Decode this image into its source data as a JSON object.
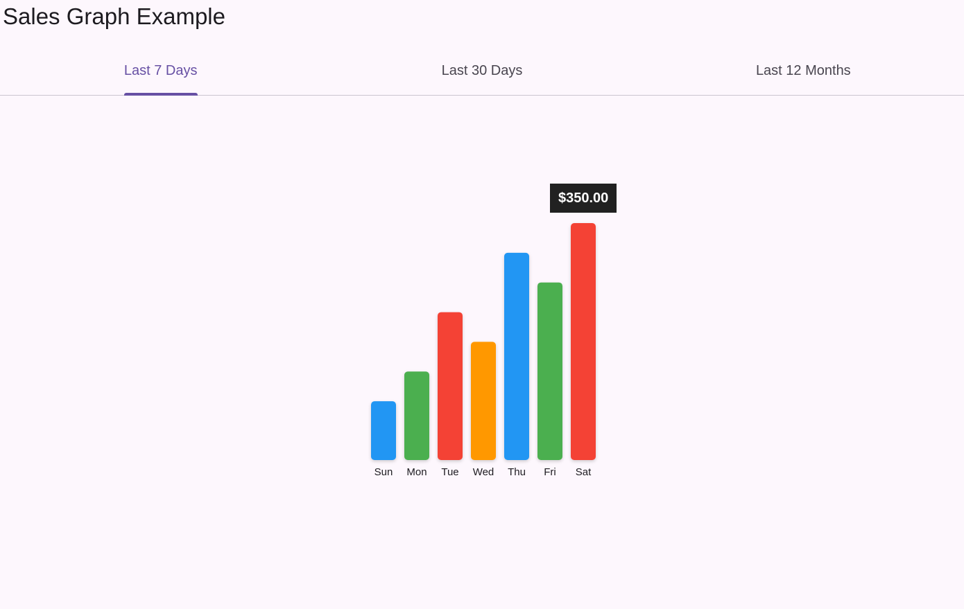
{
  "app": {
    "title": "Sales Graph Example"
  },
  "tabs": [
    {
      "label": "Last 7 Days",
      "active": true
    },
    {
      "label": "Last 30 Days",
      "active": false
    },
    {
      "label": "Last 12 Months",
      "active": false
    }
  ],
  "colors": {
    "accent": "#6750a4",
    "tab_inactive": "#49454f",
    "divider": "#cac4d0",
    "background": "#fdf7fd",
    "tooltip_bg": "#212121",
    "bar_palette": [
      "#2196f3",
      "#4caf50",
      "#f44336",
      "#ff9800"
    ]
  },
  "tooltip": {
    "text": "$350.00",
    "category": "Sat"
  },
  "chart_data": {
    "type": "bar",
    "categories": [
      "Sun",
      "Mon",
      "Tue",
      "Wed",
      "Thu",
      "Fri",
      "Sat"
    ],
    "values": [
      50,
      100,
      200,
      150,
      300,
      250,
      350
    ],
    "bar_colors": [
      "#2196f3",
      "#4caf50",
      "#f44336",
      "#ff9800",
      "#2196f3",
      "#4caf50",
      "#f44336"
    ],
    "ylim": [
      0,
      350
    ],
    "grid": false,
    "title": "",
    "xlabel": "",
    "ylabel": ""
  }
}
